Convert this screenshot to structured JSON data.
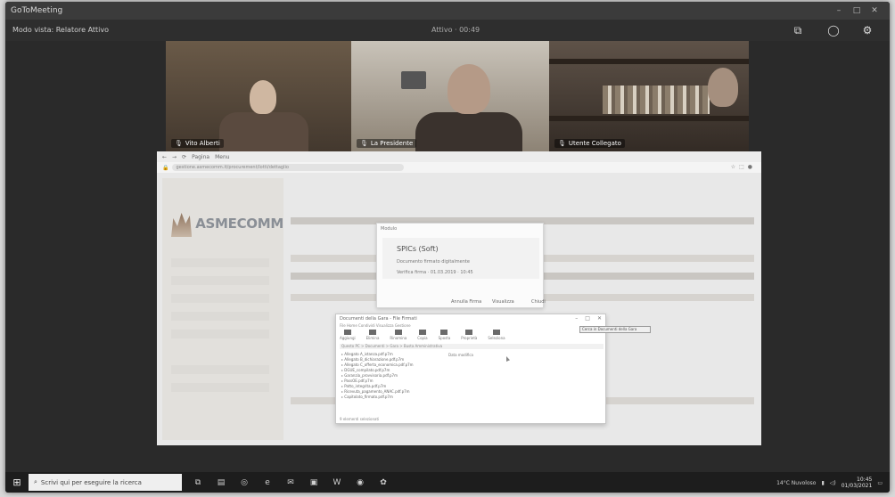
{
  "meeting": {
    "window_title": "GoToMeeting",
    "mode_label": "Modo vista: Relatore Attivo",
    "timer": "Attivo · 00:49"
  },
  "participants": [
    {
      "name": "Vito Alberti",
      "tile": "left"
    },
    {
      "name": "La Presidente",
      "tile": "center"
    },
    {
      "name": "Utente Collegato",
      "tile": "right"
    }
  ],
  "shared_screen": {
    "browser": {
      "url": "gestione.asmecomm.it/procurement/lotti/dettaglio",
      "tab_labels": [
        "Pagina",
        "Menu"
      ]
    },
    "site": {
      "logo_text": "ASMECOMM"
    },
    "dialog": {
      "title": "Modulo",
      "heading": "SPICs (Soft)",
      "line1": "Documento firmato digitalmente",
      "line2": "Verifica firma · 01.03.2019 · 10:45",
      "btn1": "Annulla Firma",
      "btn2": "Visualizza",
      "btn3": "Chiudi"
    },
    "explorer": {
      "title": "Documenti della Gara - File Firmati",
      "menu": "File  Home  Condividi  Visualizza  Gestione",
      "ribbon": [
        "Aggiungi",
        "Elimina",
        "Rinomina",
        "Copia",
        "Sposta",
        "Proprietà",
        "Seleziona"
      ],
      "path": "Questo PC > Documenti > Gara > Busta Amministrativa",
      "items": [
        "Allegato A_istanza.pdf.p7m",
        "Allegato B_dichiarazione.pdf.p7m",
        "Allegato C_offerta_economica.pdf.p7m",
        "DGUE_compilato.pdf.p7m",
        "Garanzia_provvisoria.pdf.p7m",
        "PassOE.pdf.p7m",
        "Patto_integrita.pdf.p7m",
        "Ricevuta_pagamento_ANAC.pdf.p7m",
        "Capitolato_firmato.pdf.p7m"
      ],
      "side_note": "Data modifica",
      "status": "9 elementi selezionati",
      "tooltip": "Cerca in Documenti della Gara"
    }
  },
  "taskbar": {
    "search_placeholder": "Scrivi qui per eseguire la ricerca",
    "tray_weather": "14°C Nuvoloso",
    "clock_time": "10:45",
    "clock_date": "01/03/2021"
  }
}
